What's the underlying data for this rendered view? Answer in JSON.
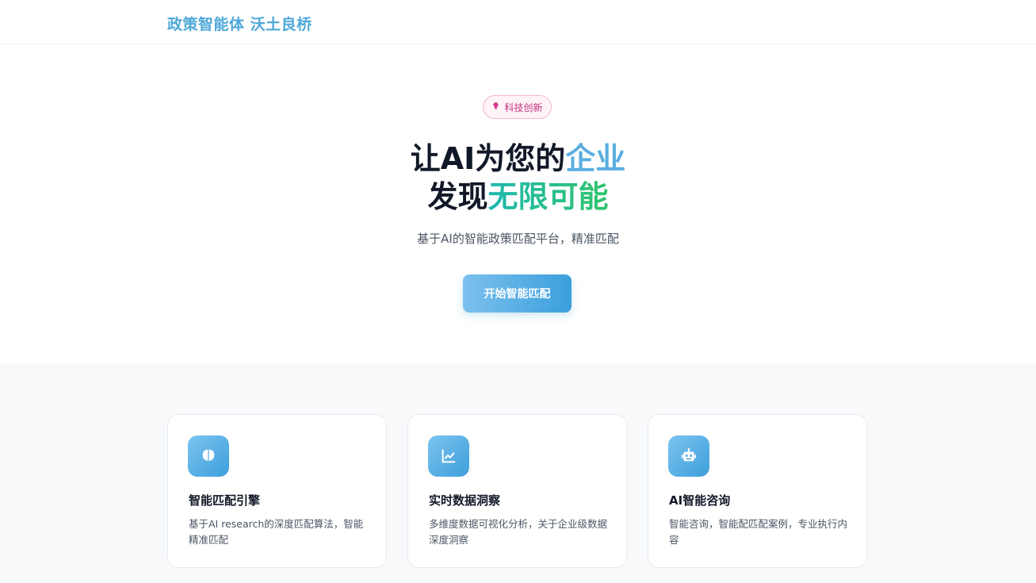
{
  "header": {
    "brand": "政策智能体 沃土良桥"
  },
  "hero": {
    "badge_icon": "lightbulb-icon",
    "badge_label": "科技创新",
    "headline_line1_plain": "让AI为您的",
    "headline_line1_highlight": "企业",
    "headline_line2_plain": "发现",
    "headline_line2_highlight": "无限可能",
    "subtitle": "基于AI的智能政策匹配平台，精准匹配",
    "cta_label": "开始智能匹配"
  },
  "features": [
    {
      "icon": "brain-icon",
      "title": "智能匹配引擎",
      "description": "基于AI research的深度匹配算法，智能精准匹配"
    },
    {
      "icon": "line-chart-icon",
      "title": "实时数据洞察",
      "description": "多维度数据可视化分析，关于企业级数据深度洞察"
    },
    {
      "icon": "robot-icon",
      "title": "AI智能咨询",
      "description": "智能咨询，智能配匹配案例，专业执行内容"
    }
  ],
  "colors": {
    "brand": "#4ea8d8",
    "accent_blue": "#5aaee0",
    "accent_green": "#2fc46a",
    "badge_pink": "#c0327a"
  }
}
